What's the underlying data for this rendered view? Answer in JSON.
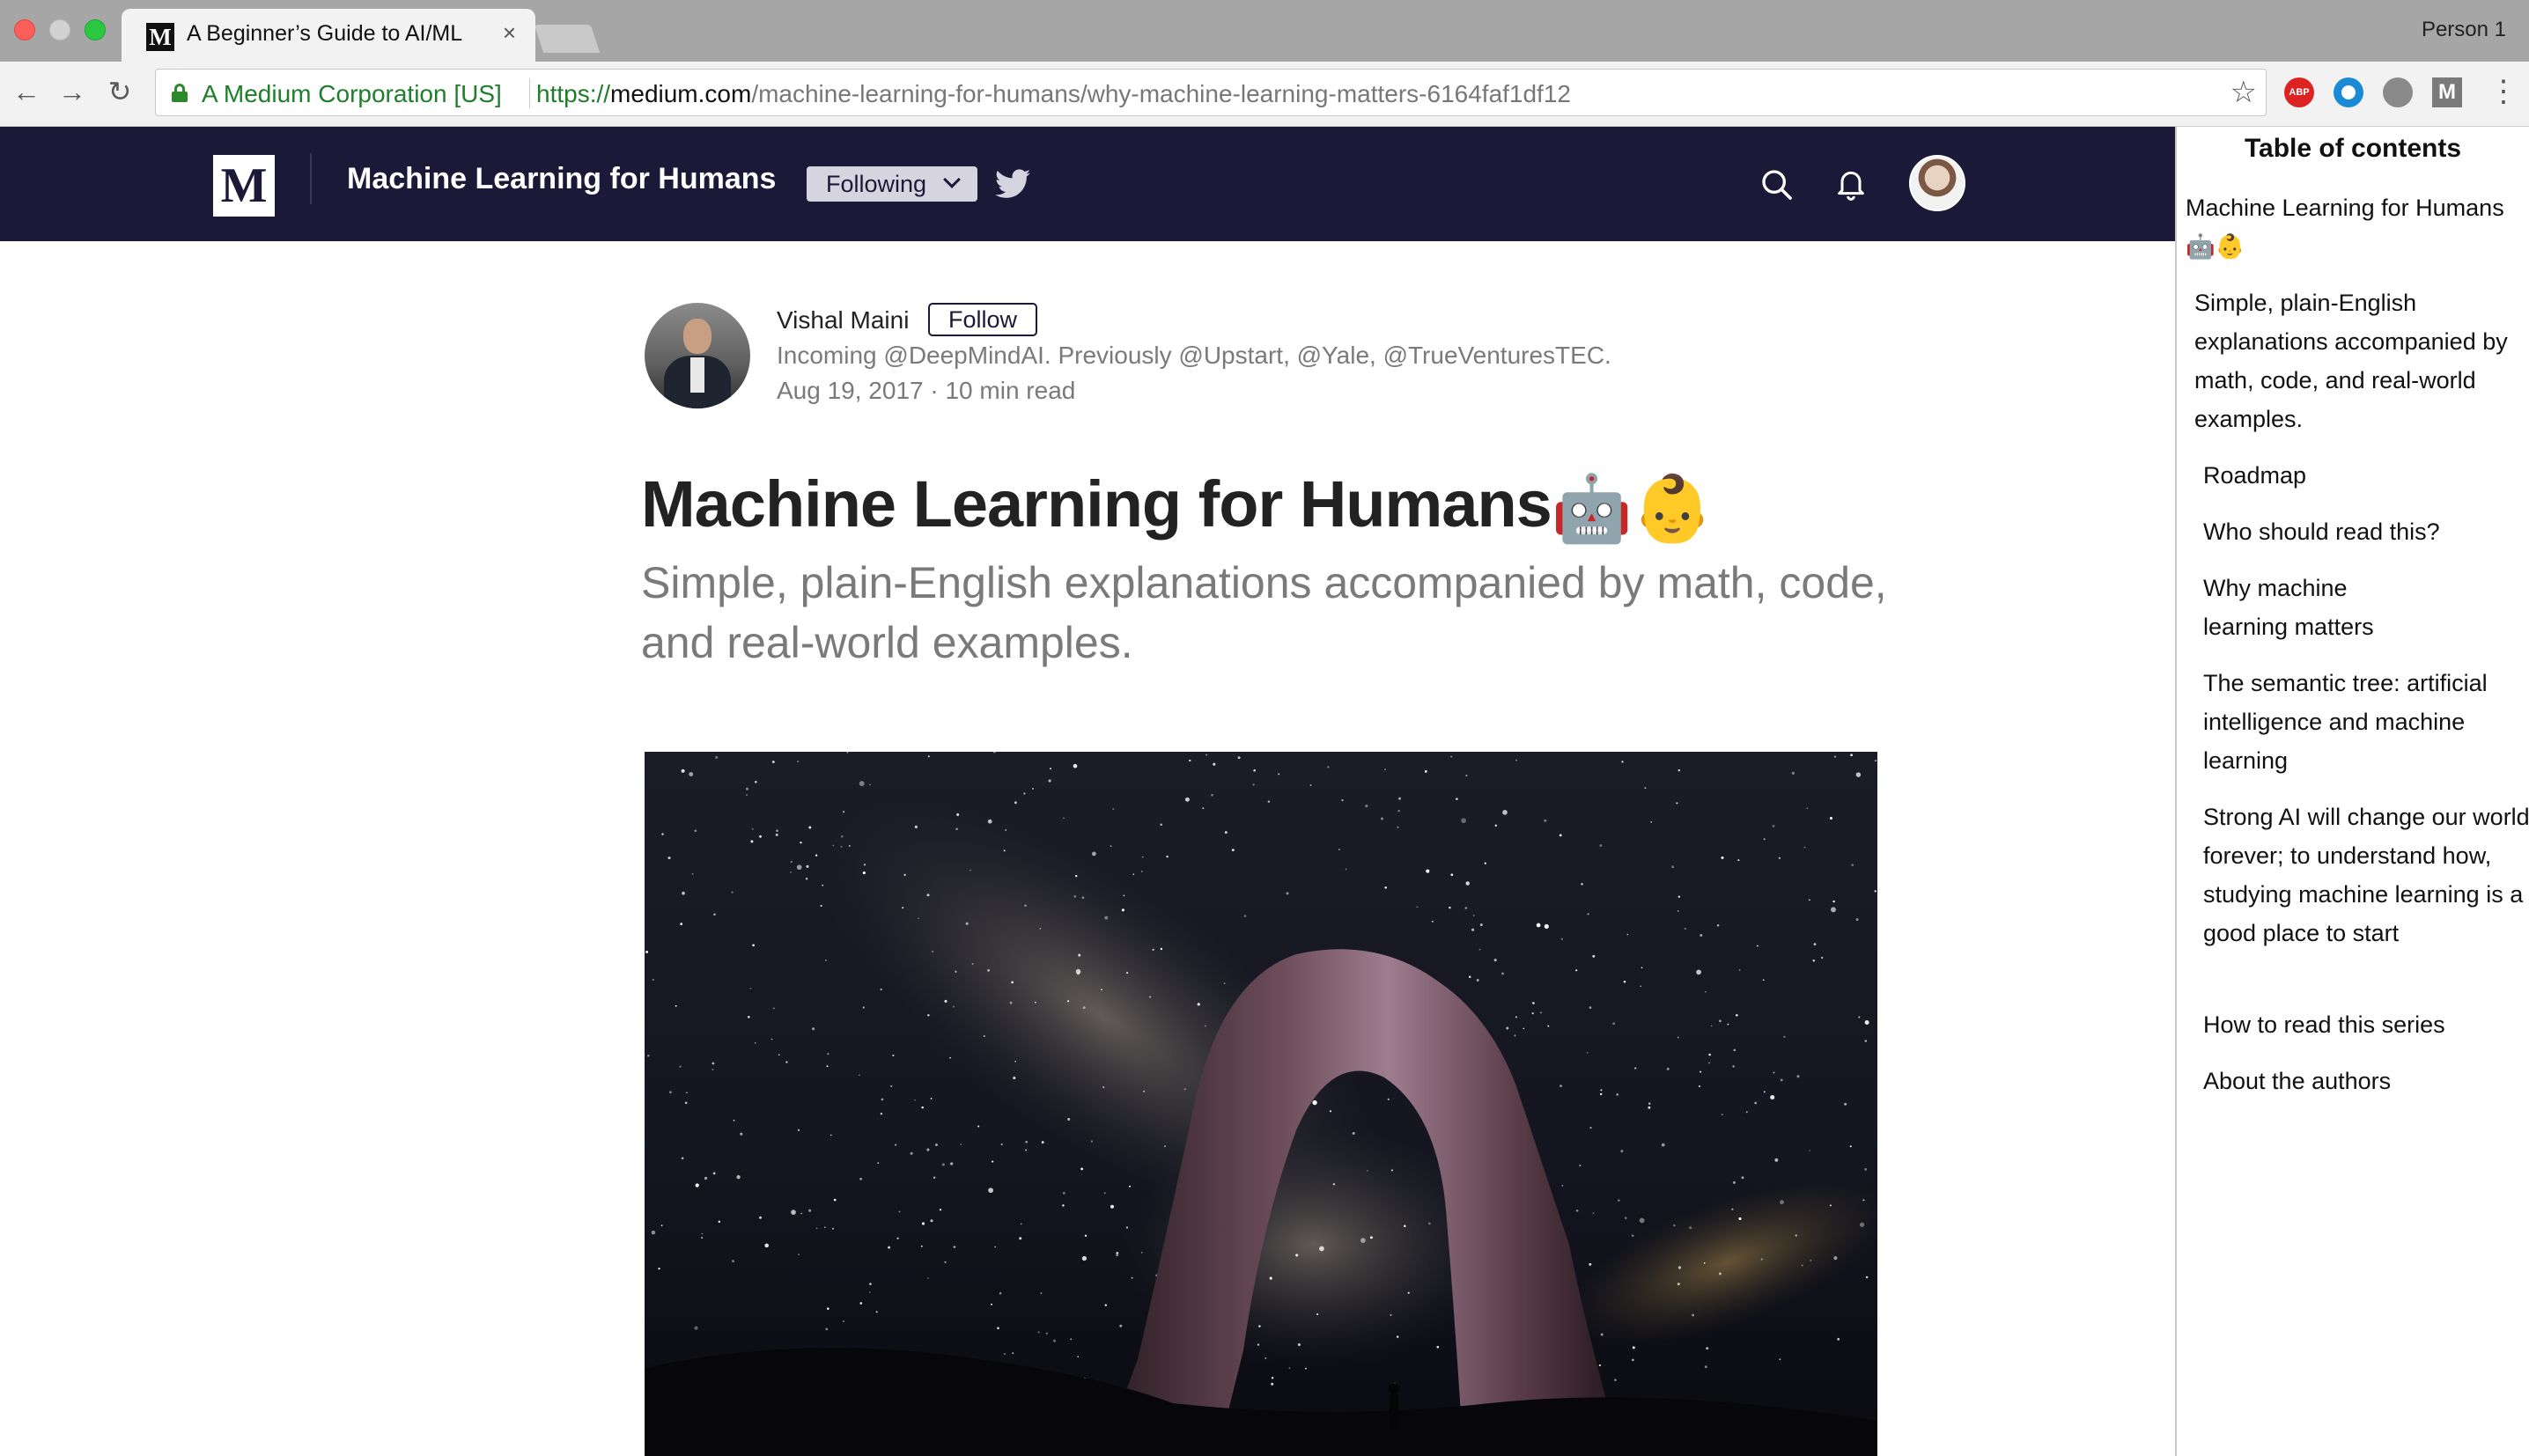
{
  "browser": {
    "tab_title": "A Beginner’s Guide to AI/ML",
    "tab_favicon": "M",
    "profile": "Person 1",
    "ev_label": "A Medium Corporation [US]",
    "url_scheme": "https://",
    "url_host": "medium.com",
    "url_path": "/machine-learning-for-humans/why-machine-learning-matters-6164faf1df12",
    "extensions": [
      "adblock-plus-icon",
      "blue-ring-extension-icon",
      "gray-extension-icon",
      "medium-extension-icon"
    ],
    "ext_abp_text": "ABP",
    "ext_m_text": "M"
  },
  "navbar": {
    "logo": "M",
    "publication": "Machine Learning for Humans",
    "following_label": "Following",
    "bg_color": "#1c1837"
  },
  "author": {
    "name": "Vishal Maini",
    "follow_label": "Follow",
    "bio": "Incoming @DeepMindAI. Previously @Upstart, @Yale, @TrueVenturesTEC.",
    "date": "Aug 19, 2017",
    "read_time": "10 min read"
  },
  "article": {
    "title": "Machine Learning for Humans",
    "title_emoji": "🤖👶",
    "subtitle": "Simple, plain-English explanations accompanied by math, code, and real-world examples."
  },
  "toc": {
    "heading": "Table of contents",
    "items": [
      "Machine Learning for Humans 🤖👶",
      "Simple, plain-English explanations accompanied by math, code, and real-world examples.",
      "Roadmap",
      "Who should read this?",
      "Why machine learning matters",
      "The semantic tree: artificial intelligence and machine learning",
      "Strong AI will change our world forever; to understand how, studying machine learning is a good place to start",
      "How to read this series",
      "About the authors"
    ]
  }
}
